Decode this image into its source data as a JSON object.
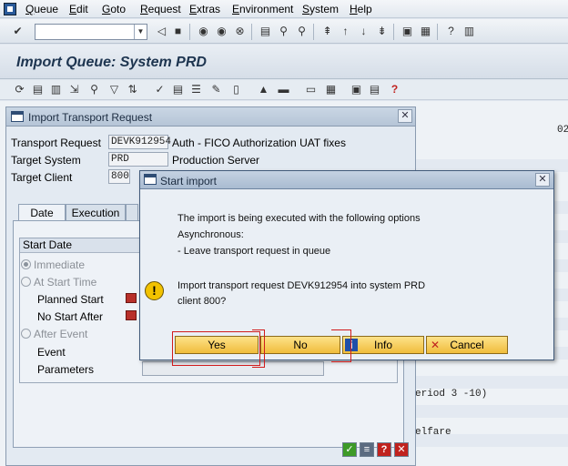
{
  "menu": [
    "Queue",
    "Edit",
    "Goto",
    "Request",
    "Extras",
    "Environment",
    "System",
    "Help"
  ],
  "title": "Import Queue: System PRD",
  "background": {
    "text_period": "eriod 3 -10)",
    "text_welfare": "elfare",
    "top_right_fragment": "02"
  },
  "import_window": {
    "title": "Import Transport Request",
    "fields": {
      "transport_request_label": "Transport Request",
      "transport_request_value": "DEVK912954",
      "transport_request_desc": "Auth - FICO Authorization UAT fixes",
      "target_system_label": "Target System",
      "target_system_value": "PRD",
      "target_system_desc": "Production Server",
      "target_client_label": "Target Client",
      "target_client_value": "800"
    },
    "tabs": [
      "Date",
      "Execution"
    ],
    "start_date": {
      "heading": "Start Date",
      "immediate": "Immediate",
      "at_start_time": "At Start Time",
      "planned_start": "Planned Start",
      "no_start_after": "No Start After",
      "after_event": "After Event",
      "event": "Event",
      "parameters": "Parameters"
    }
  },
  "start_import": {
    "title": "Start import",
    "line1": "The import is being executed with the following options",
    "line2": "Asynchronous:",
    "line3": "- Leave transport request in queue",
    "question1": "Import transport request DEVK912954 into system PRD",
    "question2": "client 800?",
    "buttons": {
      "yes": "Yes",
      "no": "No",
      "info": "Info",
      "cancel": "Cancel"
    }
  },
  "icons": {
    "warning": "warning-icon",
    "info": "info-icon",
    "cancel": "cancel-icon"
  },
  "colors": {
    "button_yellow": "#f0bd3c",
    "highlight_red": "#d11c1c",
    "warning": "#f2c200"
  }
}
